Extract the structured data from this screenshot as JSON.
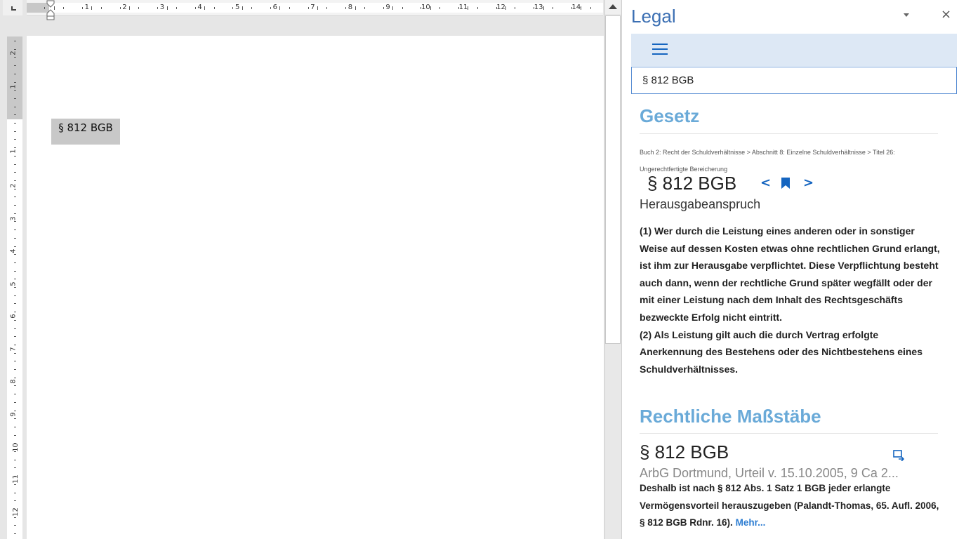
{
  "document": {
    "ruler_numbers": [
      "1",
      "2",
      "3",
      "4",
      "5",
      "6",
      "7",
      "8",
      "9",
      "10",
      "11",
      "12",
      "13",
      "14"
    ],
    "vertical_ruler_numbers": [
      "2",
      "1",
      "1",
      "2",
      "3",
      "4",
      "5",
      "6",
      "7",
      "8",
      "9",
      "10",
      "11",
      "12"
    ],
    "text": "§ 812 BGB"
  },
  "panel": {
    "title": "Legal",
    "dropdown_icon": "caret-down",
    "close_label": "×",
    "menu_icon": "hamburger-icon",
    "search_value": "§ 812 BGB",
    "law_section": {
      "heading": "Gesetz",
      "breadcrumb_line1": "Buch 2: Recht der Schuldverhältnisse > Abschnitt 8: Einzelne Schuldverhältnisse > Titel 26:",
      "breadcrumb_line2": "Ungerechtfertigte Bereicherung",
      "paragraph_title": "§ 812 BGB",
      "nav_prev": "<",
      "nav_next": ">",
      "subtitle": "Herausgabeanspruch",
      "text_p1": "(1) Wer durch die Leistung eines anderen oder in sonstiger Weise auf dessen Kosten etwas ohne rechtlichen Grund erlangt, ist ihm zur Herausgabe verpflichtet. Diese Verpflichtung besteht auch dann, wenn der rechtliche Grund später wegfällt oder der mit einer Leistung nach dem Inhalt des Rechtsgeschäfts bezweckte Erfolg nicht eintritt.",
      "text_p2": "(2) Als Leistung gilt auch die durch Vertrag erfolgte Anerkennung des Bestehens oder des Nichtbestehens eines Schuldverhältnisses."
    },
    "standards_section": {
      "heading": "Rechtliche Maßstäbe",
      "case_title": "§ 812 BGB",
      "case_court": "ArbG Dortmund, Urteil v. 15.10.2005, 9 Ca 2...",
      "case_excerpt": "Deshalb ist nach § 812 Abs. 1 Satz 1 BGB jeder erlangte Vermögensvorteil herauszugeben (Palandt-Thomas, 65. Aufl. 2006, § 812 BGB Rdnr. 16).",
      "more_link": "Mehr..."
    }
  },
  "colors": {
    "accent_blue": "#1565c0",
    "heading_blue": "#6aaad8",
    "menu_bar_bg": "#dde8f5",
    "selection_gray": "#c8c8c8"
  }
}
